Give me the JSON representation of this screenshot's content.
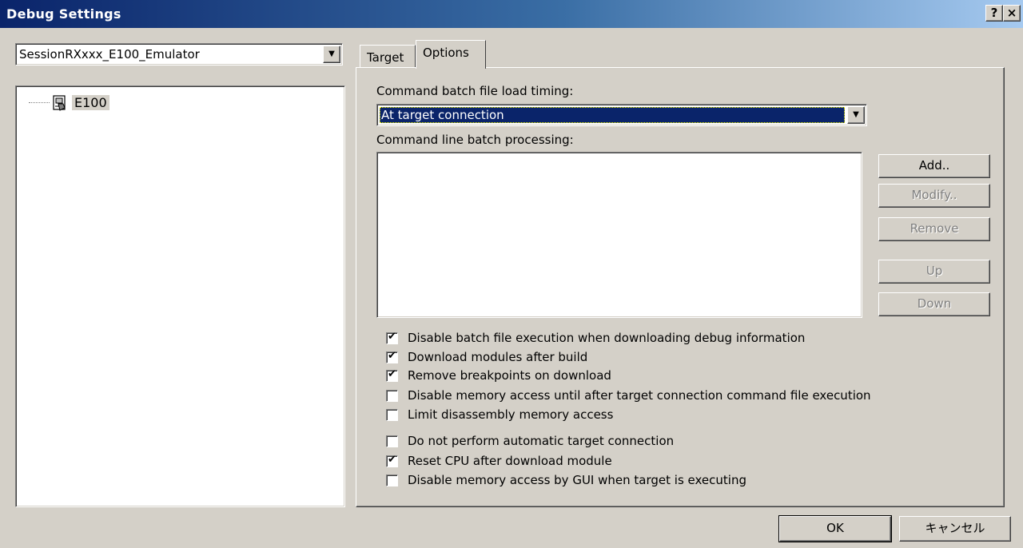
{
  "window": {
    "title": "Debug Settings",
    "help_label": "?",
    "close_label": "×"
  },
  "session": {
    "value": "SessionRXxxx_E100_Emulator",
    "arrow": "▼"
  },
  "tree": {
    "root_label": "E100"
  },
  "tabs": [
    {
      "label": "Target"
    },
    {
      "label": "Options"
    }
  ],
  "options": {
    "timing_label": "Command batch file load timing:",
    "timing_value": "At target connection",
    "batch_label": "Command line batch processing:",
    "buttons": [
      {
        "label": "Add..",
        "enabled": true
      },
      {
        "label": "Modify..",
        "enabled": false
      },
      {
        "label": "Remove",
        "enabled": false
      },
      {
        "label": "Up",
        "enabled": false
      },
      {
        "label": "Down",
        "enabled": false
      }
    ],
    "checkboxes": [
      {
        "label": "Disable batch file execution when downloading debug information",
        "checked": true
      },
      {
        "label": "Download modules after build",
        "checked": true
      },
      {
        "label": "Remove breakpoints on download",
        "checked": true
      },
      {
        "label": "Disable memory access until after target connection command file execution",
        "checked": false
      },
      {
        "label": "Limit disassembly memory access",
        "checked": false
      },
      {
        "label": "Do not perform automatic target connection",
        "checked": false
      },
      {
        "label": "Reset CPU after download module",
        "checked": true
      },
      {
        "label": "Disable memory access by GUI when target is executing",
        "checked": false
      }
    ]
  },
  "footer": {
    "ok_label": "OK",
    "cancel_label": "キャンセル"
  }
}
